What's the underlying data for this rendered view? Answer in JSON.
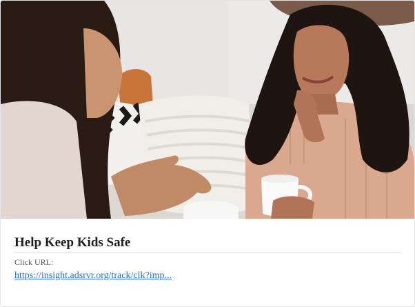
{
  "card": {
    "image_alt": "Two women talking on a couch, one holding a white mug",
    "title": "Help Keep Kids Safe",
    "click_label": "Click URL:",
    "click_url": "https://insight.adsrvr.org/track/clk?imp..."
  },
  "colors": {
    "title": "#1f1f1f",
    "link": "#2a6fc9",
    "label": "#555555",
    "divider": "#dcdcdc"
  }
}
